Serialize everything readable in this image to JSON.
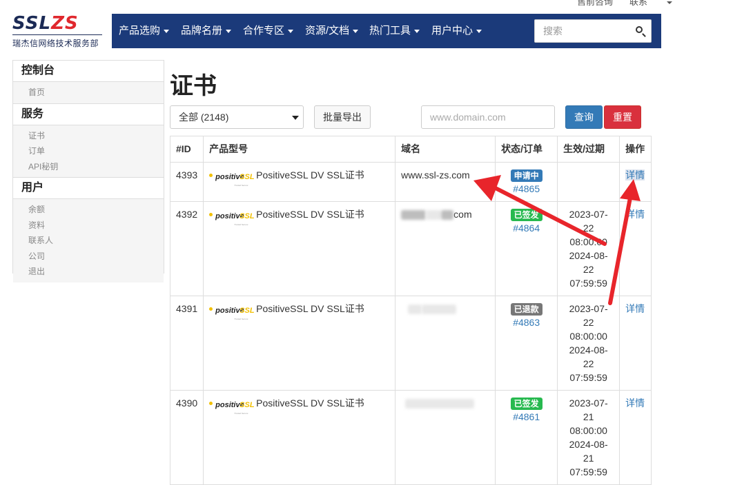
{
  "top_links": {
    "consult": "售前咨询",
    "contact": "联系"
  },
  "logo": {
    "mark_left": "SSL",
    "mark_right": "ZS",
    "subtitle": "瑞杰信网络技术服务部"
  },
  "nav": {
    "items": [
      "产品选购",
      "品牌名册",
      "合作专区",
      "资源/文档",
      "热门工具",
      "用户中心"
    ],
    "search_placeholder": "搜索"
  },
  "sidebar": {
    "sections": [
      {
        "title": "控制台",
        "items": [
          "首页"
        ]
      },
      {
        "title": "服务",
        "items": [
          "证书",
          "订单",
          "API秘钥"
        ]
      },
      {
        "title": "用户",
        "items": [
          "余额",
          "资料",
          "联系人",
          "公司",
          "退出"
        ]
      }
    ]
  },
  "main": {
    "title": "证书",
    "filter_value": "全部 (2148)",
    "export_label": "批量导出",
    "domain_placeholder": "www.domain.com",
    "query_label": "查询",
    "reset_label": "重置"
  },
  "table": {
    "headers": [
      "#ID",
      "产品型号",
      "域名",
      "状态/订单",
      "生效/过期",
      "操作"
    ],
    "brand_logo": {
      "positive": "positive",
      "ssl": "SSL",
      "tagline": "Trusted Secure"
    },
    "rows": [
      {
        "id": "4393",
        "product": "PositiveSSL DV SSL证书",
        "domain": "www.ssl-zs.com",
        "status": "申请中",
        "status_color": "#337ab7",
        "order": "#4865",
        "valid": [],
        "action": "详情"
      },
      {
        "id": "4392",
        "product": "PositiveSSL DV SSL证书",
        "domain": "com",
        "status": "已签发",
        "status_color": "#27b94f",
        "order": "#4864",
        "valid": [
          "2023-07-",
          "22",
          "08:00:00",
          "2024-08-",
          "22",
          "07:59:59"
        ],
        "action": "详情"
      },
      {
        "id": "4391",
        "product": "PositiveSSL DV SSL证书",
        "domain": "",
        "status": "已退款",
        "status_color": "#777777",
        "order": "#4863",
        "valid": [
          "2023-07-",
          "22",
          "08:00:00",
          "2024-08-",
          "22",
          "07:59:59"
        ],
        "action": "详情"
      },
      {
        "id": "4390",
        "product": "PositiveSSL DV SSL证书",
        "domain": "",
        "status": "已签发",
        "status_color": "#27b94f",
        "order": "#4861",
        "valid": [
          "2023-07-",
          "21",
          "08:00:00",
          "2024-08-",
          "21",
          "07:59:59"
        ],
        "action": "详情"
      }
    ]
  },
  "colors": {
    "nav_bg": "#1b3a7a",
    "link": "#337ab7",
    "query": "#337ab7",
    "reset": "#d9303d",
    "arrow": "#e8252b"
  }
}
